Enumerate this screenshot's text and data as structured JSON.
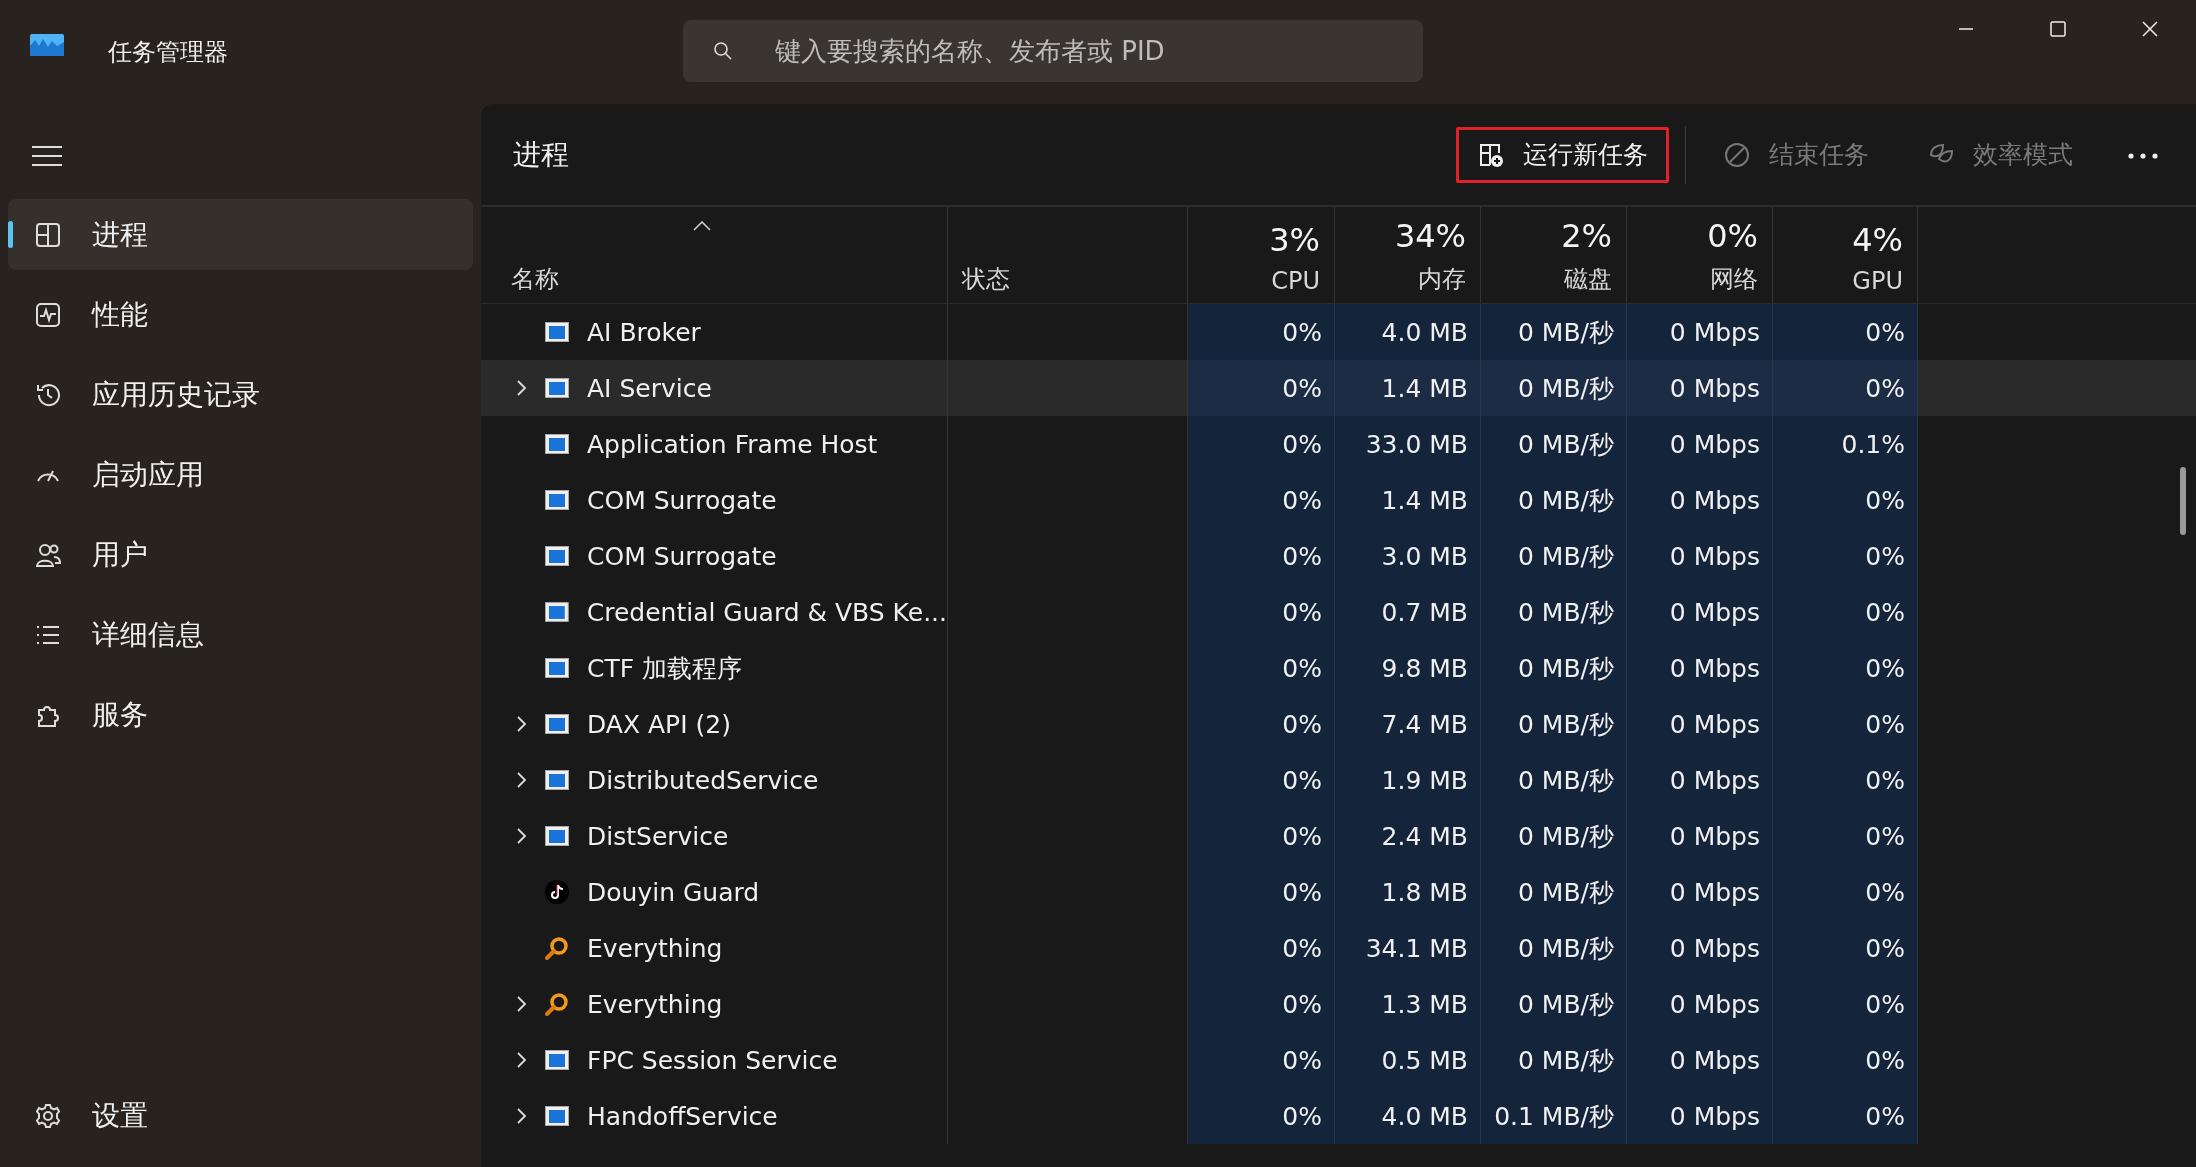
{
  "window": {
    "title": "任务管理器"
  },
  "search": {
    "placeholder": "键入要搜索的名称、发布者或 PID"
  },
  "sidebar": {
    "items": [
      {
        "label": "进程",
        "selected": true
      },
      {
        "label": "性能",
        "selected": false
      },
      {
        "label": "应用历史记录",
        "selected": false
      },
      {
        "label": "启动应用",
        "selected": false
      },
      {
        "label": "用户",
        "selected": false
      },
      {
        "label": "详细信息",
        "selected": false
      },
      {
        "label": "服务",
        "selected": false
      }
    ],
    "settings": {
      "label": "设置"
    }
  },
  "page": {
    "title": "进程"
  },
  "toolbar": [
    {
      "label": "运行新任务",
      "disabled": false,
      "highlighted": true
    },
    {
      "label": "结束任务",
      "disabled": true,
      "highlighted": false
    },
    {
      "label": "效率模式",
      "disabled": true,
      "highlighted": false
    }
  ],
  "table": {
    "columns": [
      {
        "label": "名称",
        "kind": "name"
      },
      {
        "label": "状态",
        "kind": "status"
      },
      {
        "label": "CPU",
        "total": "3%",
        "kind": "metric"
      },
      {
        "label": "内存",
        "total": "34%",
        "kind": "metric"
      },
      {
        "label": "磁盘",
        "total": "2%",
        "kind": "metric"
      },
      {
        "label": "网络",
        "total": "0%",
        "kind": "metric"
      },
      {
        "label": "GPU",
        "total": "4%",
        "kind": "metric"
      }
    ],
    "rows": [
      {
        "name": "AI Broker",
        "kind": "app",
        "expandable": false,
        "hovered": false,
        "values": [
          "0%",
          "4.0 MB",
          "0 MB/秒",
          "0 Mbps",
          "0%"
        ]
      },
      {
        "name": "AI Service",
        "kind": "app",
        "expandable": true,
        "hovered": true,
        "values": [
          "0%",
          "1.4 MB",
          "0 MB/秒",
          "0 Mbps",
          "0%"
        ]
      },
      {
        "name": "Application Frame Host",
        "kind": "app",
        "expandable": false,
        "hovered": false,
        "values": [
          "0%",
          "33.0 MB",
          "0 MB/秒",
          "0 Mbps",
          "0.1%"
        ]
      },
      {
        "name": "COM Surrogate",
        "kind": "app",
        "expandable": false,
        "hovered": false,
        "values": [
          "0%",
          "1.4 MB",
          "0 MB/秒",
          "0 Mbps",
          "0%"
        ]
      },
      {
        "name": "COM Surrogate",
        "kind": "app",
        "expandable": false,
        "hovered": false,
        "values": [
          "0%",
          "3.0 MB",
          "0 MB/秒",
          "0 Mbps",
          "0%"
        ]
      },
      {
        "name": "Credential Guard & VBS Ke...",
        "kind": "app",
        "expandable": false,
        "hovered": false,
        "values": [
          "0%",
          "0.7 MB",
          "0 MB/秒",
          "0 Mbps",
          "0%"
        ]
      },
      {
        "name": "CTF 加载程序",
        "kind": "app",
        "expandable": false,
        "hovered": false,
        "values": [
          "0%",
          "9.8 MB",
          "0 MB/秒",
          "0 Mbps",
          "0%"
        ]
      },
      {
        "name": "DAX API (2)",
        "kind": "app",
        "expandable": true,
        "hovered": false,
        "values": [
          "0%",
          "7.4 MB",
          "0 MB/秒",
          "0 Mbps",
          "0%"
        ]
      },
      {
        "name": "DistributedService",
        "kind": "app",
        "expandable": true,
        "hovered": false,
        "values": [
          "0%",
          "1.9 MB",
          "0 MB/秒",
          "0 Mbps",
          "0%"
        ]
      },
      {
        "name": "DistService",
        "kind": "app",
        "expandable": true,
        "hovered": false,
        "values": [
          "0%",
          "2.4 MB",
          "0 MB/秒",
          "0 Mbps",
          "0%"
        ]
      },
      {
        "name": "Douyin Guard",
        "kind": "note",
        "expandable": false,
        "hovered": false,
        "values": [
          "0%",
          "1.8 MB",
          "0 MB/秒",
          "0 Mbps",
          "0%"
        ]
      },
      {
        "name": "Everything",
        "kind": "magnifier",
        "expandable": false,
        "hovered": false,
        "values": [
          "0%",
          "34.1 MB",
          "0 MB/秒",
          "0 Mbps",
          "0%"
        ]
      },
      {
        "name": "Everything",
        "kind": "magnifier",
        "expandable": true,
        "hovered": false,
        "values": [
          "0%",
          "1.3 MB",
          "0 MB/秒",
          "0 Mbps",
          "0%"
        ]
      },
      {
        "name": "FPC Session Service",
        "kind": "app",
        "expandable": true,
        "hovered": false,
        "values": [
          "0%",
          "0.5 MB",
          "0 MB/秒",
          "0 Mbps",
          "0%"
        ]
      },
      {
        "name": "HandoffService",
        "kind": "app",
        "expandable": true,
        "hovered": false,
        "values": [
          "0%",
          "4.0 MB",
          "0.1 MB/秒",
          "0 Mbps",
          "0%"
        ]
      }
    ]
  }
}
